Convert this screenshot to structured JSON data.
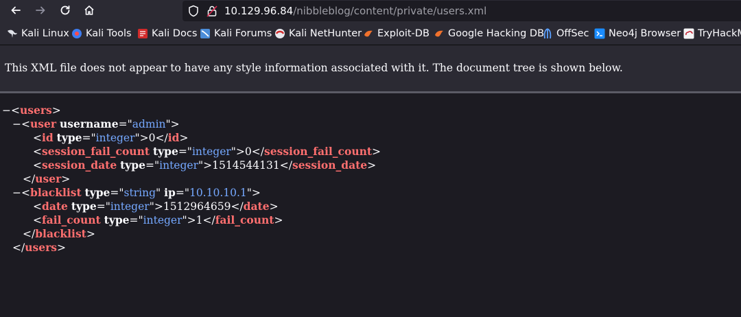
{
  "browser": {
    "url_host": "10.129.96.84",
    "url_path": "/nibbleblog/content/private/users.xml"
  },
  "bookmarks": [
    {
      "label": "Kali Linux",
      "icon": "kali-dragon-icon"
    },
    {
      "label": "Kali Tools",
      "icon": "kali-tools-icon"
    },
    {
      "label": "Kali Docs",
      "icon": "kali-docs-icon"
    },
    {
      "label": "Kali Forums",
      "icon": "kali-forums-icon"
    },
    {
      "label": "Kali NetHunter",
      "icon": "kali-nethunter-icon"
    },
    {
      "label": "Exploit-DB",
      "icon": "exploit-db-icon"
    },
    {
      "label": "Google Hacking DB",
      "icon": "ghdb-icon"
    },
    {
      "label": "OffSec",
      "icon": "offsec-icon"
    },
    {
      "label": "Neo4j Browser",
      "icon": "neo4j-icon"
    },
    {
      "label": "TryHackM",
      "icon": "tryhackme-icon"
    }
  ],
  "notice": "This XML file does not appear to have any style information associated with it. The document tree is shown below.",
  "xml": {
    "toggle": "−",
    "users_tag": "users",
    "user_tag": "user",
    "username_attr": "username",
    "username_val": "admin",
    "id_tag": "id",
    "id_type_attr": "type",
    "id_type_val": "integer",
    "id_val": "0",
    "sfc_tag": "session_fail_count",
    "sfc_type_attr": "type",
    "sfc_type_val": "integer",
    "sfc_val": "0",
    "sd_tag": "session_date",
    "sd_type_attr": "type",
    "sd_type_val": "integer",
    "sd_val": "1514544131",
    "blacklist_tag": "blacklist",
    "bl_type_attr": "type",
    "bl_type_val": "string",
    "bl_ip_attr": "ip",
    "bl_ip_val": "10.10.10.1",
    "date_tag": "date",
    "date_type_attr": "type",
    "date_type_val": "integer",
    "date_val": "1512964659",
    "fc_tag": "fail_count",
    "fc_type_attr": "type",
    "fc_type_val": "integer",
    "fc_val": "1"
  },
  "colors": {
    "tag": "#ff6f6f",
    "attr_value": "#75a8ff",
    "background": "#1c1b22",
    "chrome": "#2b2a33"
  }
}
